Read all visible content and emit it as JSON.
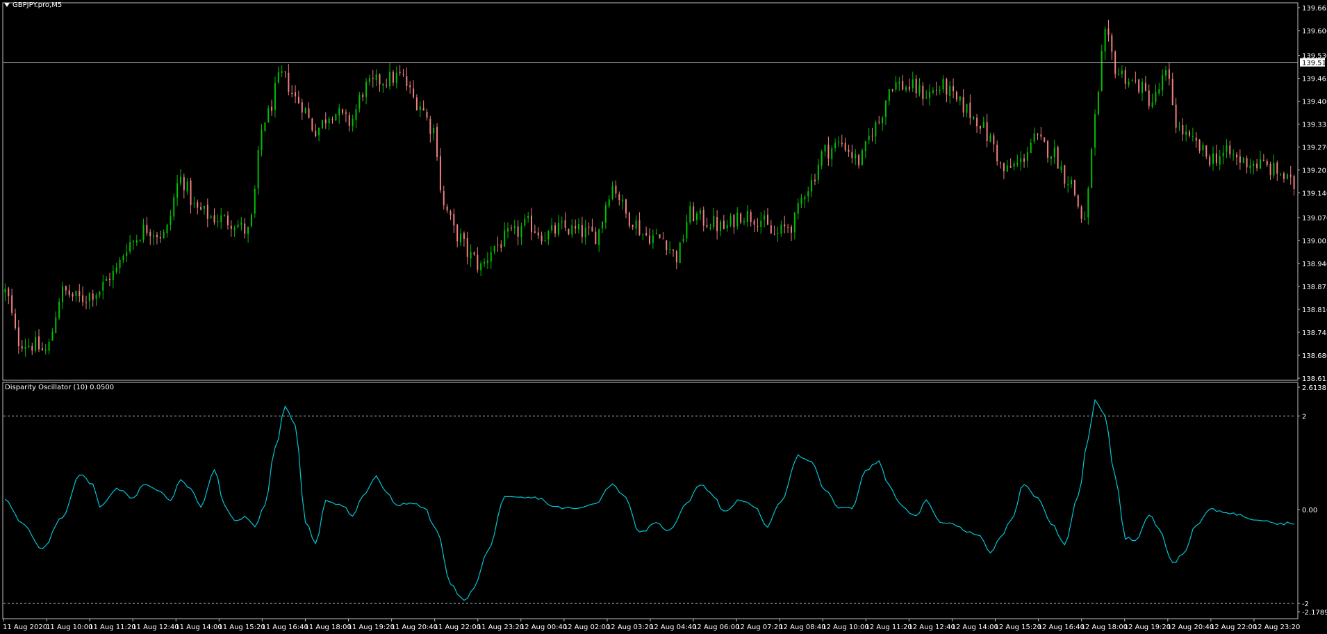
{
  "window": {
    "symbol_label": "GBPJPY.pro,M5",
    "indicator_label": "Disparity Oscillator (10) 0.0500"
  },
  "colors": {
    "background": "#000000",
    "bull": "#00c000",
    "bear": "#f08080",
    "oscillator": "#00c8d8",
    "grid_text": "#ffffff",
    "frame": "#c0c0c0"
  },
  "icons": [
    "dropdown-triangle-icon"
  ],
  "chart_data": [
    {
      "type": "candlestick",
      "title": "GBPJPY.pro,M5",
      "ylim": [
        138.615,
        139.665
      ],
      "yticks": [
        "139.665",
        "139.600",
        "139.530",
        "139.465",
        "139.400",
        "139.335",
        "139.270",
        "139.205",
        "139.140",
        "139.070",
        "139.005",
        "138.940",
        "138.875",
        "138.810",
        "138.745",
        "138.680",
        "138.615"
      ],
      "ytick_values": [
        139.665,
        139.6,
        139.53,
        139.465,
        139.4,
        139.335,
        139.27,
        139.205,
        139.14,
        139.07,
        139.005,
        138.94,
        138.875,
        138.81,
        138.745,
        138.68,
        138.615
      ],
      "current_price_line": 139.51,
      "current_price_label": "139.510",
      "x_labels": [
        "11 Aug 2020",
        "11 Aug 10:00",
        "11 Aug 11:20",
        "11 Aug 12:40",
        "11 Aug 14:00",
        "11 Aug 15:20",
        "11 Aug 16:40",
        "11 Aug 18:00",
        "11 Aug 19:20",
        "11 Aug 20:40",
        "11 Aug 22:00",
        "11 Aug 23:20",
        "12 Aug 00:40",
        "12 Aug 02:00",
        "12 Aug 03:20",
        "12 Aug 04:40",
        "12 Aug 06:00",
        "12 Aug 07:20",
        "12 Aug 08:40",
        "12 Aug 10:00",
        "12 Aug 11:20",
        "12 Aug 12:40",
        "12 Aug 14:00",
        "12 Aug 15:20",
        "12 Aug 16:40",
        "12 Aug 18:00",
        "12 Aug 19:20",
        "12 Aug 20:40",
        "12 Aug 22:00",
        "12 Aug 23:20"
      ],
      "close_anchors": [
        [
          0,
          138.86
        ],
        [
          4,
          138.72
        ],
        [
          8,
          138.71
        ],
        [
          12,
          138.69
        ],
        [
          17,
          138.86
        ],
        [
          22,
          138.84
        ],
        [
          27,
          138.86
        ],
        [
          32,
          138.91
        ],
        [
          37,
          139.0
        ],
        [
          42,
          139.04
        ],
        [
          47,
          139.02
        ],
        [
          52,
          139.18
        ],
        [
          57,
          139.09
        ],
        [
          62,
          139.07
        ],
        [
          67,
          139.06
        ],
        [
          72,
          139.03
        ],
        [
          77,
          139.35
        ],
        [
          82,
          139.47
        ],
        [
          87,
          139.4
        ],
        [
          92,
          139.32
        ],
        [
          97,
          139.37
        ],
        [
          102,
          139.34
        ],
        [
          107,
          139.44
        ],
        [
          112,
          139.46
        ],
        [
          117,
          139.47
        ],
        [
          122,
          139.4
        ],
        [
          127,
          139.32
        ],
        [
          130,
          139.1
        ],
        [
          134,
          139.02
        ],
        [
          138,
          138.96
        ],
        [
          141,
          138.93
        ],
        [
          145,
          138.99
        ],
        [
          150,
          139.02
        ],
        [
          155,
          139.05
        ],
        [
          160,
          139.02
        ],
        [
          165,
          139.04
        ],
        [
          170,
          139.03
        ],
        [
          175,
          139.02
        ],
        [
          180,
          139.16
        ],
        [
          185,
          139.07
        ],
        [
          190,
          139.02
        ],
        [
          195,
          139.01
        ],
        [
          199,
          138.96
        ],
        [
          203,
          139.08
        ],
        [
          208,
          139.06
        ],
        [
          213,
          139.04
        ],
        [
          218,
          139.08
        ],
        [
          223,
          139.07
        ],
        [
          228,
          139.02
        ],
        [
          233,
          139.05
        ],
        [
          238,
          139.16
        ],
        [
          243,
          139.26
        ],
        [
          248,
          139.28
        ],
        [
          253,
          139.23
        ],
        [
          258,
          139.33
        ],
        [
          263,
          139.45
        ],
        [
          268,
          139.44
        ],
        [
          273,
          139.42
        ],
        [
          278,
          139.44
        ],
        [
          283,
          139.39
        ],
        [
          288,
          139.35
        ],
        [
          292,
          139.29
        ],
        [
          296,
          139.2
        ],
        [
          300,
          139.22
        ],
        [
          305,
          139.29
        ],
        [
          310,
          139.26
        ],
        [
          315,
          139.18
        ],
        [
          320,
          139.06
        ],
        [
          323,
          139.35
        ],
        [
          326,
          139.58
        ],
        [
          330,
          139.48
        ],
        [
          335,
          139.45
        ],
        [
          340,
          139.4
        ],
        [
          344,
          139.47
        ],
        [
          348,
          139.32
        ],
        [
          352,
          139.28
        ],
        [
          357,
          139.24
        ],
        [
          362,
          139.25
        ],
        [
          367,
          139.23
        ],
        [
          372,
          139.22
        ],
        [
          377,
          139.2
        ],
        [
          382,
          139.16
        ]
      ],
      "n_bars": 383
    },
    {
      "type": "line",
      "title": "Disparity Oscillator (10) 0.0500",
      "series": [
        {
          "name": "Disparity Oscillator (10)"
        }
      ],
      "ylim": [
        -2.1789,
        2.6138
      ],
      "yticks": [
        "2.6138",
        "2",
        "0.00",
        "-2",
        "-2.1789"
      ],
      "ytick_values": [
        2.6138,
        2,
        0,
        -2,
        -2.1789
      ],
      "levels": [
        2,
        -2
      ],
      "anchors": [
        [
          0,
          0.24
        ],
        [
          5,
          -0.3
        ],
        [
          11,
          -0.85
        ],
        [
          17,
          -0.15
        ],
        [
          22,
          0.75
        ],
        [
          26,
          0.55
        ],
        [
          28,
          0.05
        ],
        [
          33,
          0.45
        ],
        [
          38,
          0.25
        ],
        [
          41,
          0.55
        ],
        [
          46,
          0.38
        ],
        [
          49,
          0.2
        ],
        [
          52,
          0.65
        ],
        [
          55,
          0.45
        ],
        [
          58,
          0.05
        ],
        [
          62,
          0.85
        ],
        [
          65,
          0.1
        ],
        [
          68,
          -0.25
        ],
        [
          71,
          -0.15
        ],
        [
          74,
          -0.35
        ],
        [
          77,
          0.1
        ],
        [
          80,
          1.3
        ],
        [
          83,
          2.2
        ],
        [
          86,
          1.8
        ],
        [
          89,
          -0.25
        ],
        [
          92,
          -0.75
        ],
        [
          95,
          0.2
        ],
        [
          100,
          0.1
        ],
        [
          103,
          -0.15
        ],
        [
          106,
          0.3
        ],
        [
          110,
          0.7
        ],
        [
          113,
          0.35
        ],
        [
          116,
          0.1
        ],
        [
          120,
          0.15
        ],
        [
          124,
          0.05
        ],
        [
          128,
          -0.45
        ],
        [
          132,
          -1.6
        ],
        [
          136,
          -1.95
        ],
        [
          139,
          -1.65
        ],
        [
          143,
          -0.9
        ],
        [
          148,
          0.25
        ],
        [
          153,
          0.25
        ],
        [
          158,
          0.25
        ],
        [
          163,
          0.05
        ],
        [
          170,
          0.02
        ],
        [
          175,
          0.15
        ],
        [
          180,
          0.55
        ],
        [
          184,
          0.25
        ],
        [
          188,
          -0.5
        ],
        [
          193,
          -0.3
        ],
        [
          197,
          -0.45
        ],
        [
          202,
          0.15
        ],
        [
          206,
          0.55
        ],
        [
          210,
          0.3
        ],
        [
          213,
          -0.05
        ],
        [
          218,
          0.22
        ],
        [
          222,
          0.05
        ],
        [
          226,
          -0.35
        ],
        [
          230,
          0.2
        ],
        [
          235,
          1.15
        ],
        [
          239,
          1.0
        ],
        [
          243,
          0.42
        ],
        [
          247,
          0.05
        ],
        [
          251,
          0.02
        ],
        [
          255,
          0.85
        ],
        [
          259,
          1.02
        ],
        [
          262,
          0.5
        ],
        [
          266,
          0.05
        ],
        [
          270,
          -0.15
        ],
        [
          273,
          0.18
        ],
        [
          277,
          -0.25
        ],
        [
          281,
          -0.32
        ],
        [
          285,
          -0.45
        ],
        [
          289,
          -0.55
        ],
        [
          292,
          -0.95
        ],
        [
          295,
          -0.6
        ],
        [
          298,
          -0.25
        ],
        [
          302,
          0.55
        ],
        [
          306,
          0.25
        ],
        [
          310,
          -0.3
        ],
        [
          314,
          -0.72
        ],
        [
          318,
          0.3
        ],
        [
          321,
          1.5
        ],
        [
          323,
          2.35
        ],
        [
          326,
          2.0
        ],
        [
          329,
          0.7
        ],
        [
          332,
          -0.6
        ],
        [
          335,
          -0.65
        ],
        [
          339,
          -0.1
        ],
        [
          342,
          -0.4
        ],
        [
          346,
          -1.15
        ],
        [
          349,
          -0.95
        ],
        [
          353,
          -0.35
        ],
        [
          357,
          0.0
        ],
        [
          362,
          -0.05
        ],
        [
          366,
          -0.12
        ],
        [
          370,
          -0.2
        ],
        [
          374,
          -0.22
        ],
        [
          377,
          -0.3
        ],
        [
          382,
          -0.28
        ]
      ]
    }
  ]
}
